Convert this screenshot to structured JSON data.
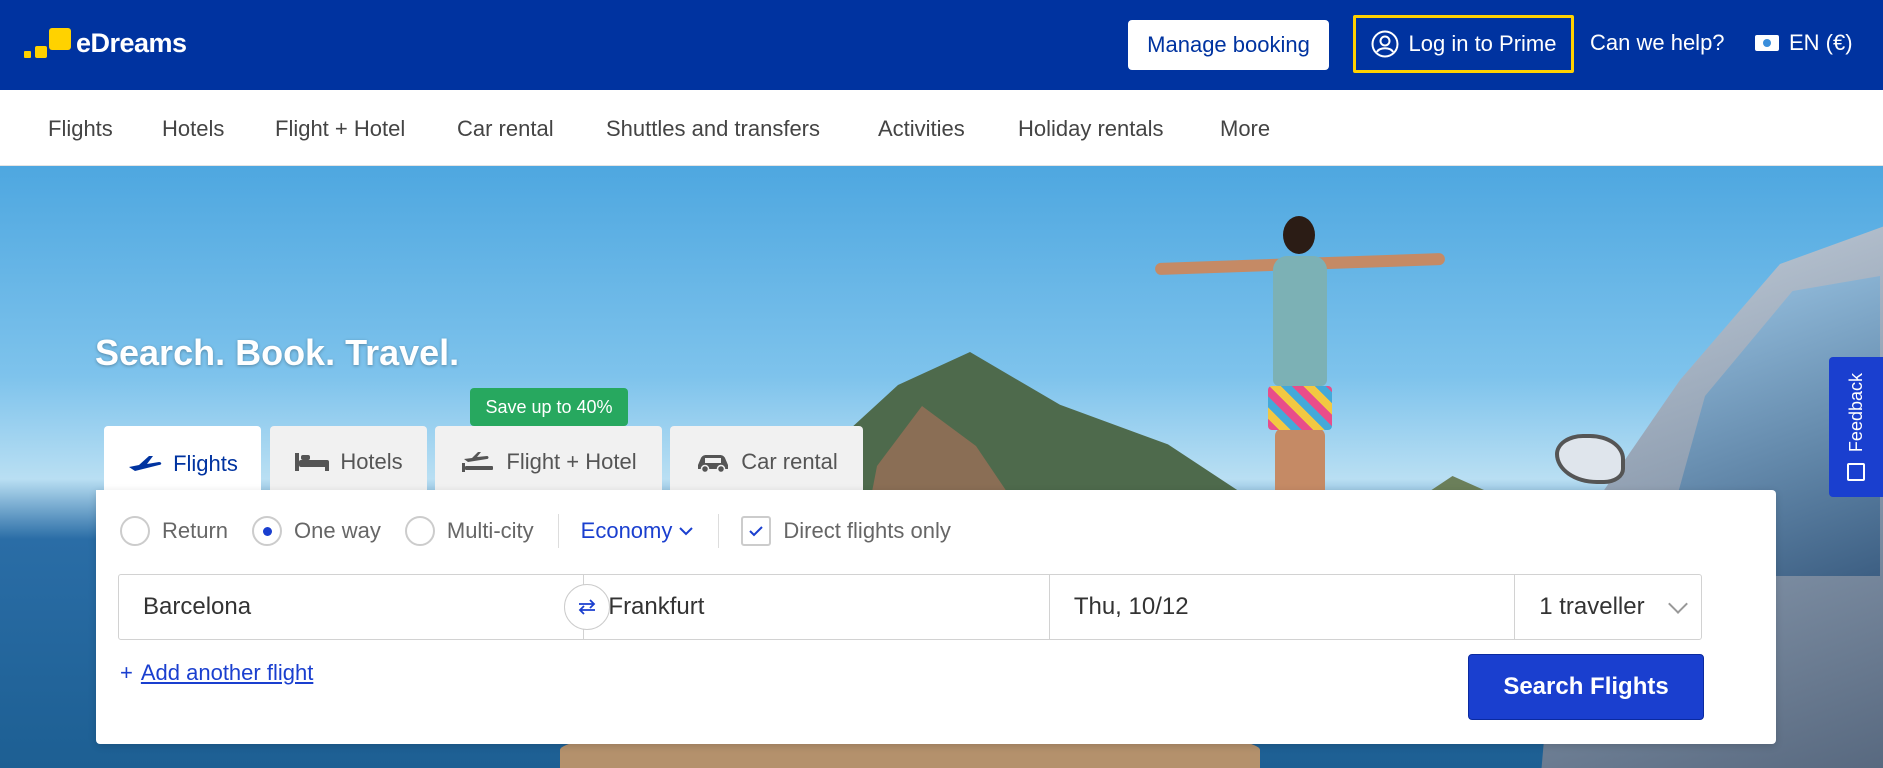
{
  "brand": {
    "name": "eDreams",
    "accent": "#ffd200",
    "primary": "#0033a0"
  },
  "header": {
    "manage_booking": "Manage booking",
    "login_prime": "Log in to Prime",
    "help": "Can we help?",
    "language": "EN (€)"
  },
  "nav": {
    "items": [
      "Flights",
      "Hotels",
      "Flight + Hotel",
      "Car rental",
      "Shuttles and transfers",
      "Activities",
      "Holiday rentals",
      "More"
    ]
  },
  "hero": {
    "headline": "Search. Book. Travel."
  },
  "tabs": [
    {
      "label": "Flights",
      "icon": "plane-icon",
      "active": true
    },
    {
      "label": "Hotels",
      "icon": "bed-icon",
      "active": false
    },
    {
      "label": "Flight + Hotel",
      "icon": "plane-hotel-icon",
      "active": false
    },
    {
      "label": "Car rental",
      "icon": "car-icon",
      "active": false
    }
  ],
  "badge": {
    "label": "Save up to 40%",
    "color": "#27a85f"
  },
  "search": {
    "trip_types": [
      {
        "label": "Return",
        "selected": false
      },
      {
        "label": "One way",
        "selected": true
      },
      {
        "label": "Multi-city",
        "selected": false
      }
    ],
    "cabin_class": "Economy",
    "direct_only_label": "Direct flights only",
    "direct_only": true,
    "origin": "Barcelona",
    "destination": "Frankfurt",
    "date": "Thu, 10/12",
    "travellers": "1 traveller",
    "add_flight": "Add another flight",
    "submit": "Search Flights",
    "button_color": "#1a3fcf"
  },
  "feedback": {
    "label": "Feedback"
  }
}
